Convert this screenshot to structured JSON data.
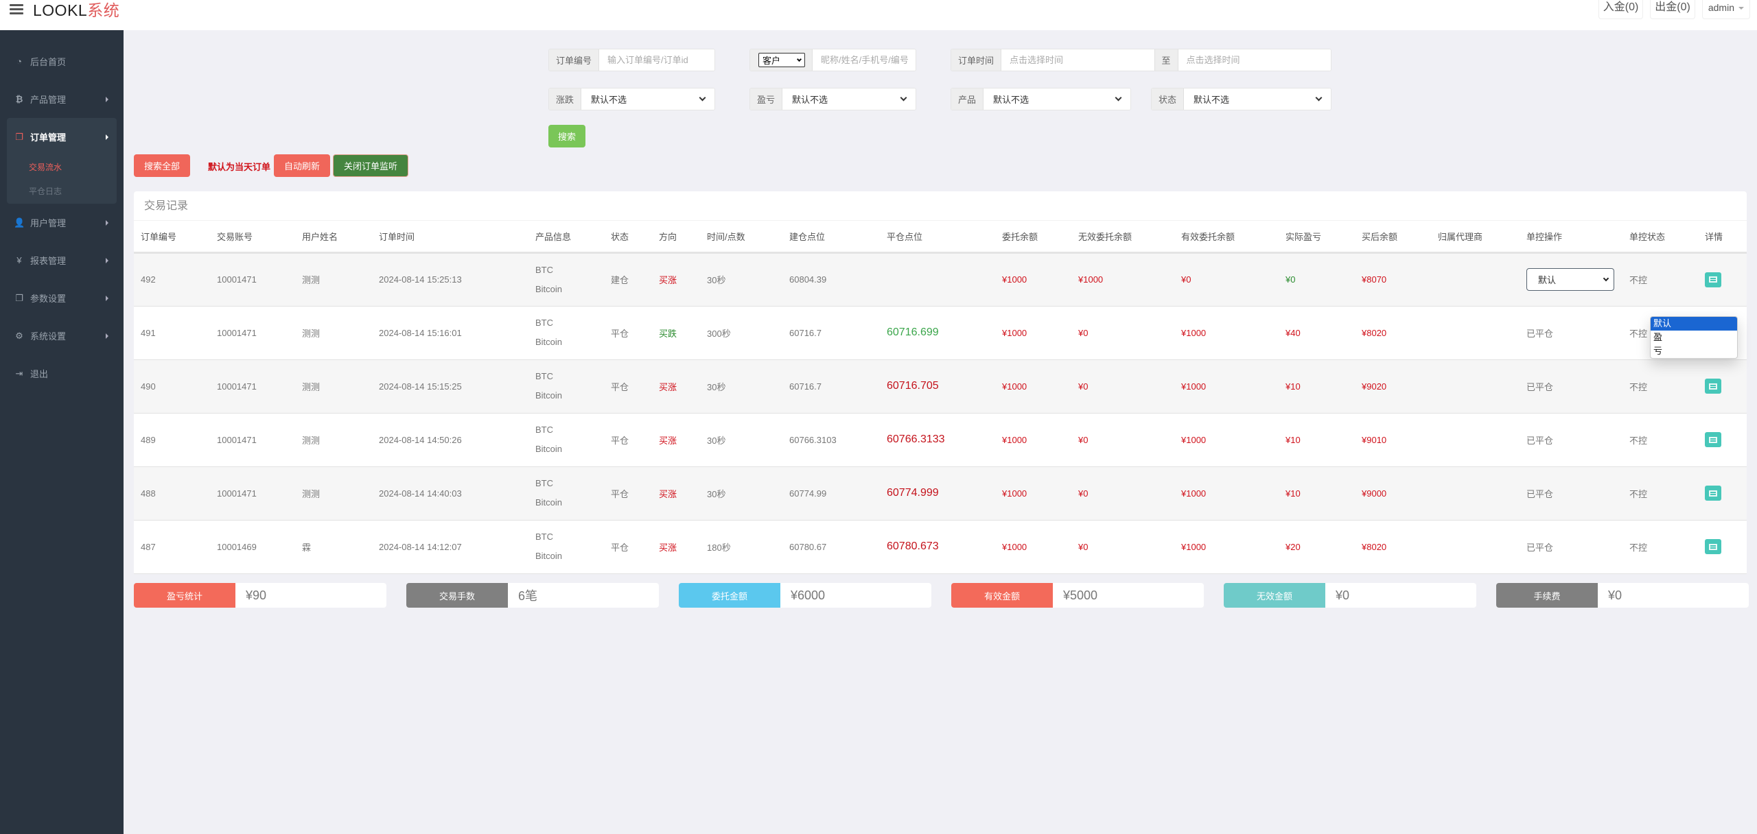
{
  "header": {
    "logo_main": "LOOKL",
    "logo_accent": "系统",
    "deposit_label": "入金(0)",
    "withdraw_label": "出金(0)",
    "user_label": "admin"
  },
  "sidebar": {
    "items": [
      {
        "label": "后台首页",
        "icon": "dashboard-icon"
      },
      {
        "label": "产品管理",
        "icon": "bitcoin-icon"
      },
      {
        "label": "订单管理",
        "icon": "copy-icon",
        "expanded": true,
        "children": [
          {
            "label": "交易流水",
            "active": true
          },
          {
            "label": "平仓日志",
            "active": false
          }
        ]
      },
      {
        "label": "用户管理",
        "icon": "user-icon"
      },
      {
        "label": "报表管理",
        "icon": "yen-icon"
      },
      {
        "label": "参数设置",
        "icon": "copy-icon"
      },
      {
        "label": "系统设置",
        "icon": "gears-icon"
      },
      {
        "label": "退出",
        "icon": "sign-out-icon"
      }
    ]
  },
  "filters": {
    "order_no": {
      "label": "订单编号",
      "placeholder": "输入订单编号/订单id",
      "value": ""
    },
    "customer": {
      "select_value": "客户",
      "placeholder": "昵称/姓名/手机号/编号",
      "value": ""
    },
    "order_time": {
      "label": "订单时间",
      "placeholder_from": "点击选择时间",
      "to_label": "至",
      "placeholder_to": "点击选择时间"
    },
    "direction": {
      "label": "涨跌",
      "value": "默认不选"
    },
    "profit": {
      "label": "盈亏",
      "value": "默认不选"
    },
    "product": {
      "label": "产品",
      "value": "默认不选"
    },
    "status": {
      "label": "状态",
      "value": "默认不选"
    },
    "search_label": "搜索"
  },
  "actions": {
    "search_all": "搜索全部",
    "default_note": "默认为当天订单",
    "auto_refresh": "自动刷新",
    "close_monitor": "关闭订单监听"
  },
  "table": {
    "title": "交易记录",
    "columns": [
      "订单编号",
      "交易账号",
      "用户姓名",
      "订单时间",
      "产品信息",
      "状态",
      "方向",
      "时间/点数",
      "建仓点位",
      "平仓点位",
      "委托余额",
      "无效委托余额",
      "有效委托余额",
      "实际盈亏",
      "买后余额",
      "归属代理商",
      "单控操作",
      "单控状态",
      "详情"
    ],
    "rows": [
      {
        "id": "492",
        "account": "10001471",
        "name": "测测",
        "time": "2024-08-14 15:25:13",
        "product_code": "BTC",
        "product_name": "Bitcoin",
        "status": "建仓",
        "direction": "买涨",
        "dir_type": "up",
        "period": "30秒",
        "open_price": "60804.39",
        "close_price": "",
        "close_type": "",
        "entrust": "¥1000",
        "invalid_entrust": "¥1000",
        "valid_entrust": "¥0",
        "pnl": "¥0",
        "pnl_type": "green",
        "balance_after": "¥8070",
        "agent": "",
        "control_op": "默认",
        "control_op_is_select": true,
        "control_status": "不控"
      },
      {
        "id": "491",
        "account": "10001471",
        "name": "测测",
        "time": "2024-08-14 15:16:01",
        "product_code": "BTC",
        "product_name": "Bitcoin",
        "status": "平仓",
        "direction": "买跌",
        "dir_type": "down",
        "period": "300秒",
        "open_price": "60716.7",
        "close_price": "60716.699",
        "close_type": "down",
        "entrust": "¥1000",
        "invalid_entrust": "¥0",
        "valid_entrust": "¥1000",
        "pnl": "¥40",
        "pnl_type": "red",
        "balance_after": "¥8020",
        "agent": "",
        "control_op": "已平仓",
        "control_op_is_select": false,
        "control_status": "不控"
      },
      {
        "id": "490",
        "account": "10001471",
        "name": "测测",
        "time": "2024-08-14 15:15:25",
        "product_code": "BTC",
        "product_name": "Bitcoin",
        "status": "平仓",
        "direction": "买涨",
        "dir_type": "up",
        "period": "30秒",
        "open_price": "60716.7",
        "close_price": "60716.705",
        "close_type": "up",
        "entrust": "¥1000",
        "invalid_entrust": "¥0",
        "valid_entrust": "¥1000",
        "pnl": "¥10",
        "pnl_type": "red",
        "balance_after": "¥9020",
        "agent": "",
        "control_op": "已平仓",
        "control_op_is_select": false,
        "control_status": "不控"
      },
      {
        "id": "489",
        "account": "10001471",
        "name": "测测",
        "time": "2024-08-14 14:50:26",
        "product_code": "BTC",
        "product_name": "Bitcoin",
        "status": "平仓",
        "direction": "买涨",
        "dir_type": "up",
        "period": "30秒",
        "open_price": "60766.3103",
        "close_price": "60766.3133",
        "close_type": "up",
        "entrust": "¥1000",
        "invalid_entrust": "¥0",
        "valid_entrust": "¥1000",
        "pnl": "¥10",
        "pnl_type": "red",
        "balance_after": "¥9010",
        "agent": "",
        "control_op": "已平仓",
        "control_op_is_select": false,
        "control_status": "不控"
      },
      {
        "id": "488",
        "account": "10001471",
        "name": "测测",
        "time": "2024-08-14 14:40:03",
        "product_code": "BTC",
        "product_name": "Bitcoin",
        "status": "平仓",
        "direction": "买涨",
        "dir_type": "up",
        "period": "30秒",
        "open_price": "60774.99",
        "close_price": "60774.999",
        "close_type": "up",
        "entrust": "¥1000",
        "invalid_entrust": "¥0",
        "valid_entrust": "¥1000",
        "pnl": "¥10",
        "pnl_type": "red",
        "balance_after": "¥9000",
        "agent": "",
        "control_op": "已平仓",
        "control_op_is_select": false,
        "control_status": "不控"
      },
      {
        "id": "487",
        "account": "10001469",
        "name": "霖",
        "time": "2024-08-14 14:12:07",
        "product_code": "BTC",
        "product_name": "Bitcoin",
        "status": "平仓",
        "direction": "买涨",
        "dir_type": "up",
        "period": "180秒",
        "open_price": "60780.67",
        "close_price": "60780.673",
        "close_type": "up",
        "entrust": "¥1000",
        "invalid_entrust": "¥0",
        "valid_entrust": "¥1000",
        "pnl": "¥20",
        "pnl_type": "red",
        "balance_after": "¥8020",
        "agent": "",
        "control_op": "已平仓",
        "control_op_is_select": false,
        "control_status": "不控"
      }
    ]
  },
  "control_dropdown": {
    "options": [
      "默认",
      "盈",
      "亏"
    ],
    "selected": "默认"
  },
  "stats": [
    {
      "label": "盈亏统计",
      "value": "¥90",
      "color": "#f36a5a"
    },
    {
      "label": "交易手数",
      "value": "6笔",
      "color": "#808080"
    },
    {
      "label": "委托金额",
      "value": "¥6000",
      "color": "#5bc8ee"
    },
    {
      "label": "有效金额",
      "value": "¥5000",
      "color": "#f36a5a"
    },
    {
      "label": "无效金额",
      "value": "¥0",
      "color": "#6fcbc9"
    },
    {
      "label": "手续费",
      "value": "¥0",
      "color": "#808080"
    }
  ]
}
